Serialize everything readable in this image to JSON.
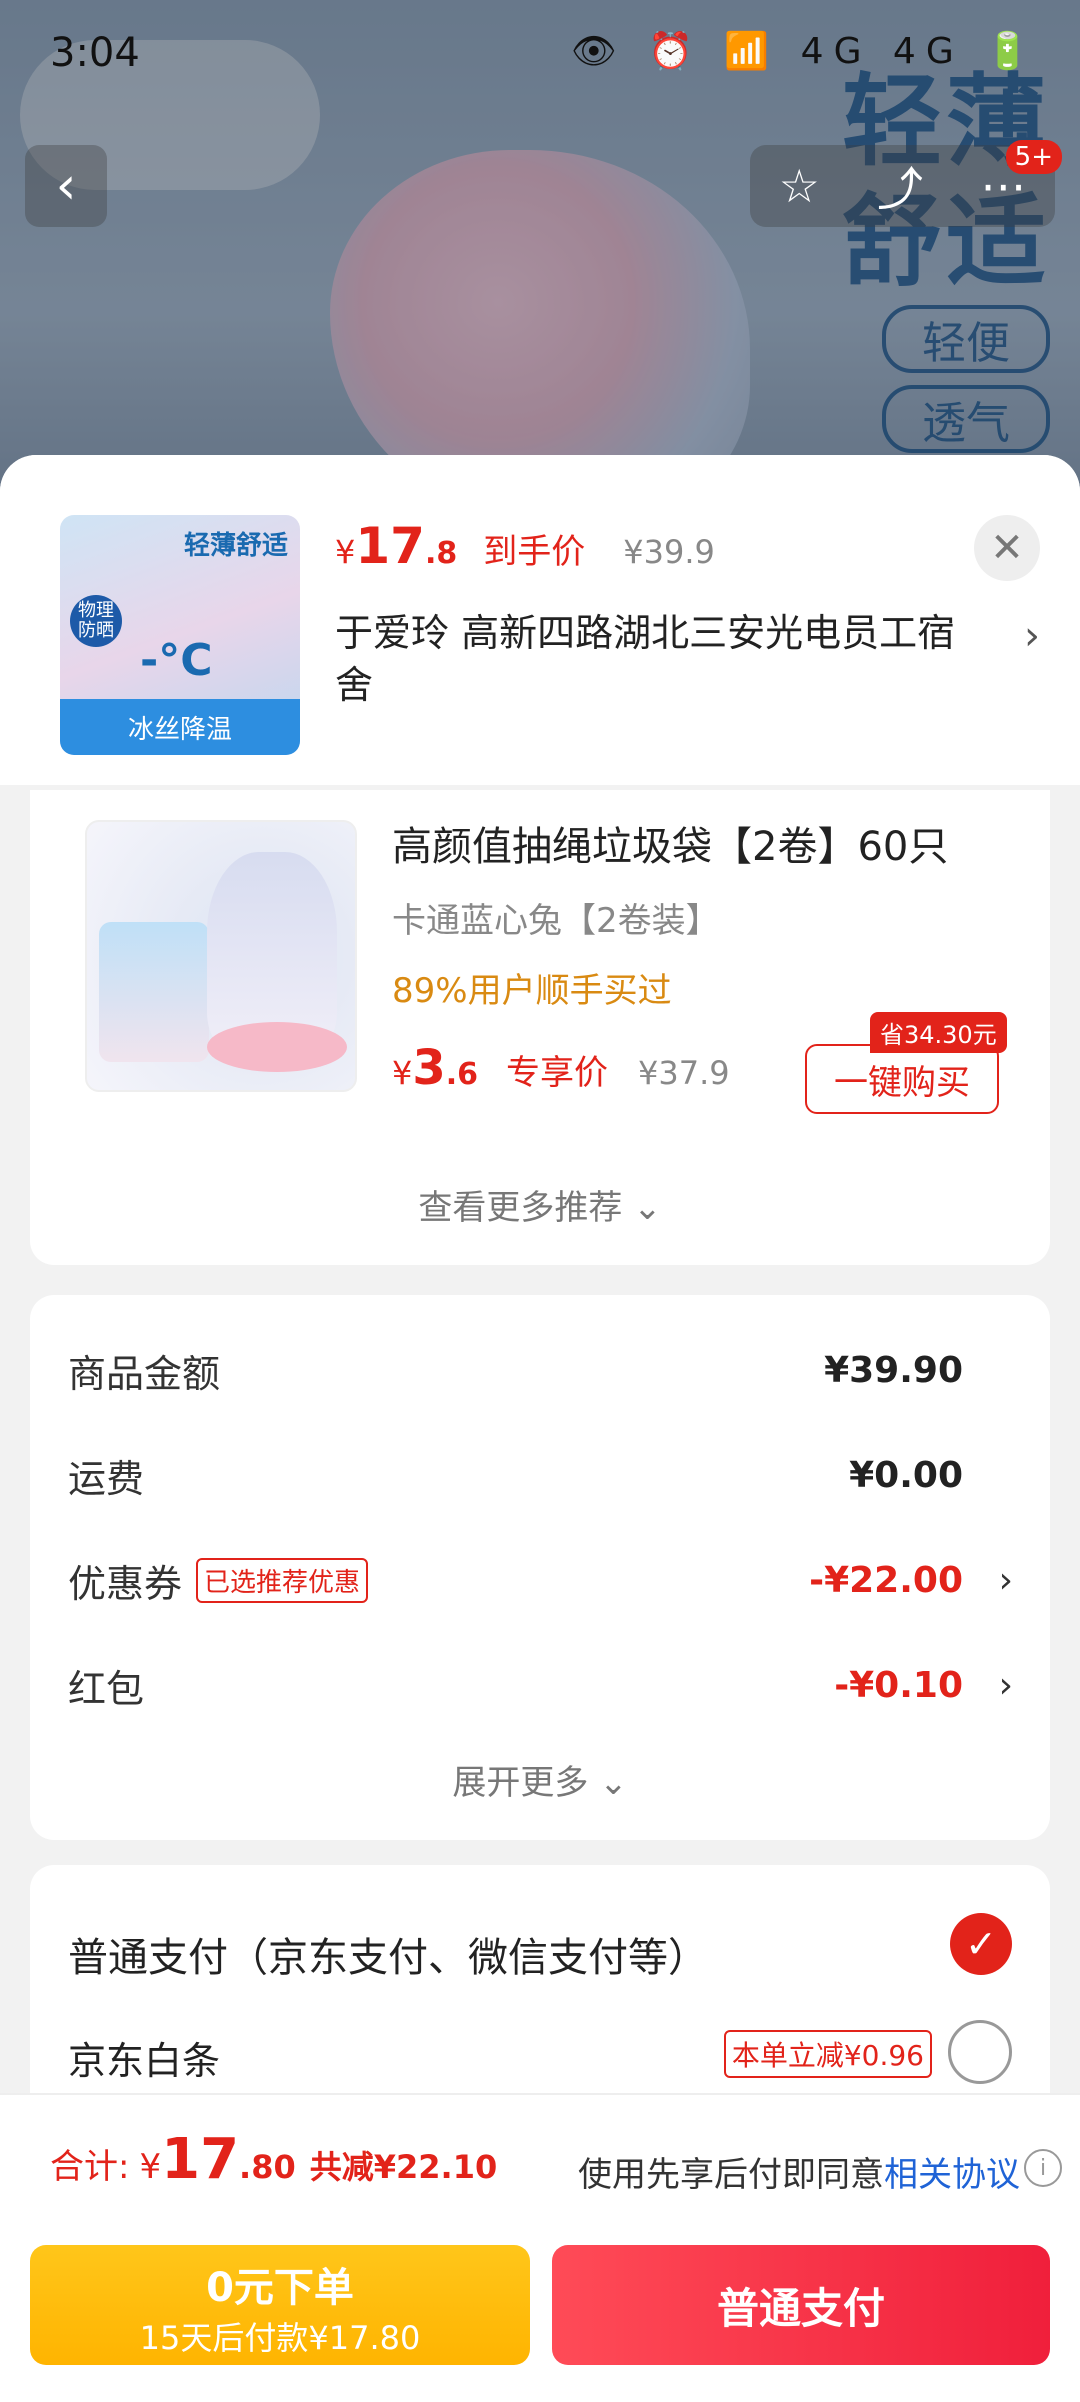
{
  "status_bar": {
    "time": "3:04",
    "icons": "👁 ⏰ 📶 4G 4G 🔋"
  },
  "hero": {
    "headline1": "轻薄",
    "headline2": "舒适",
    "pill1": "轻便",
    "pill2": "透气",
    "tool_badge": "5+"
  },
  "summary": {
    "price_yen": "¥",
    "price_int": "17",
    "price_dec": ".8",
    "price_label": "到手价",
    "original_price": "¥39.9",
    "address": "于爱玲  高新四路湖北三安光电员工宿舍",
    "thumb": {
      "top_text": "轻薄舒适",
      "badge": "物理防晒",
      "mid": "-°C",
      "bar": "冰丝降温"
    }
  },
  "recommendation": {
    "title": "高颜值抽绳垃圾袋【2卷】60只",
    "spec": "卡通蓝心兔【2卷装】",
    "stat": "89%用户顺手买过",
    "price_yen": "¥",
    "price_int": "3",
    "price_dec": ".6",
    "price_label": "专享价",
    "original_price": "¥37.9",
    "save_tag": "省34.30元",
    "buy_label": "一键购买",
    "more_label": "查看更多推荐 ⌄"
  },
  "fees": {
    "rows": [
      {
        "key": "商品金额",
        "value": "¥39.90"
      },
      {
        "key": "运费",
        "value": "¥0.00"
      },
      {
        "key": "优惠券",
        "tag": "已选推荐优惠",
        "value": "-¥22.00"
      },
      {
        "key": "红包",
        "value": "-¥0.10"
      }
    ],
    "expand_label": "展开更多 ⌄"
  },
  "payment": {
    "option1": "普通支付（京东支付、微信支付等）",
    "option2": "京东白条",
    "option2_tag": "本单立减¥0.96"
  },
  "bottom": {
    "total_label": "合计:",
    "total_yen": "¥",
    "total_int": "17",
    "total_dec": ".80",
    "total_save": "共减¥22.10",
    "agree_text": "使用先享后付即同意",
    "agree_link": "相关协议",
    "btn_yellow_l1": "0元下单",
    "btn_yellow_l2": "15天后付款¥17.80",
    "btn_red": "普通支付"
  },
  "colors": {
    "accent_red": "#e2231a",
    "link_blue": "#1f63d6",
    "yellow": "#ffb400"
  }
}
